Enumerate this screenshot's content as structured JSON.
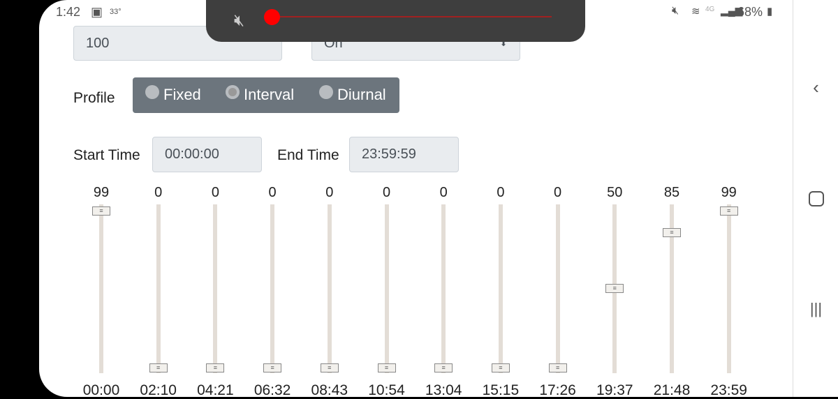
{
  "status_bar": {
    "time": "1:42",
    "temp": "33°",
    "network": "4G",
    "battery": "68%"
  },
  "form": {
    "value_field": "100",
    "mode_select": "On",
    "profile_label": "Profile",
    "profile_options": [
      {
        "label": "Fixed",
        "selected": false
      },
      {
        "label": "Interval",
        "selected": true
      },
      {
        "label": "Diurnal",
        "selected": false
      }
    ],
    "start_time_label": "Start Time",
    "start_time": "00:00:00",
    "end_time_label": "End Time",
    "end_time": "23:59:59"
  },
  "sliders": [
    {
      "time": "00:00",
      "value": 99
    },
    {
      "time": "02:10",
      "value": 0
    },
    {
      "time": "04:21",
      "value": 0
    },
    {
      "time": "06:32",
      "value": 0
    },
    {
      "time": "08:43",
      "value": 0
    },
    {
      "time": "10:54",
      "value": 0
    },
    {
      "time": "13:04",
      "value": 0
    },
    {
      "time": "15:15",
      "value": 0
    },
    {
      "time": "17:26",
      "value": 0
    },
    {
      "time": "19:37",
      "value": 50
    },
    {
      "time": "21:48",
      "value": 85
    },
    {
      "time": "23:59",
      "value": 99
    }
  ],
  "slider_range": [
    0,
    99
  ],
  "media_toast": {
    "accent": "#ff0000"
  }
}
